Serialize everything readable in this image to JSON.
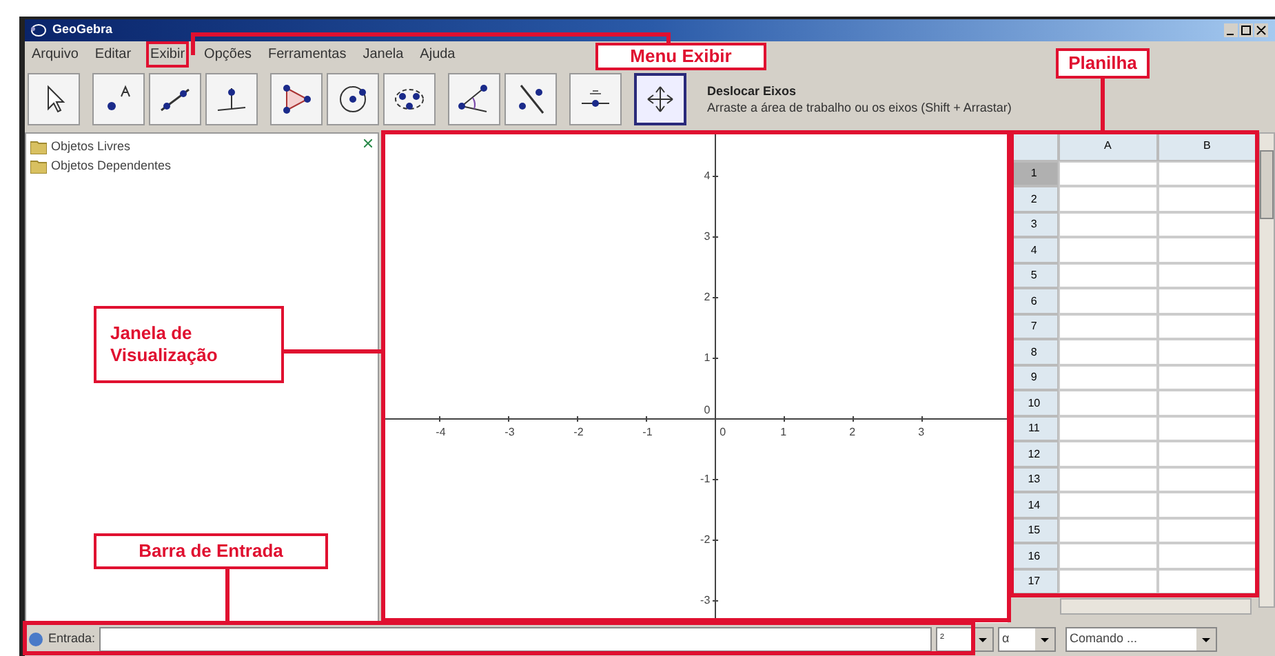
{
  "window": {
    "title": "GeoGebra"
  },
  "menu": [
    {
      "label": "Arquivo",
      "annotated": false
    },
    {
      "label": "Editar",
      "annotated": false
    },
    {
      "label": "Exibir",
      "annotated": true
    },
    {
      "label": "Opções",
      "annotated": false
    },
    {
      "label": "Ferramentas",
      "annotated": false
    },
    {
      "label": "Janela",
      "annotated": false
    },
    {
      "label": "Ajuda",
      "annotated": false
    }
  ],
  "toolbar": {
    "tools": [
      {
        "kind": "move",
        "selected": false
      },
      {
        "kind": "point",
        "selected": false
      },
      {
        "kind": "line",
        "selected": false
      },
      {
        "kind": "perpendicular",
        "selected": false
      },
      {
        "kind": "polygon",
        "selected": false
      },
      {
        "kind": "circle",
        "selected": false
      },
      {
        "kind": "conic",
        "selected": false
      },
      {
        "kind": "angle",
        "selected": false
      },
      {
        "kind": "reflect",
        "selected": false
      },
      {
        "kind": "slider",
        "selected": false
      },
      {
        "kind": "move-view",
        "selected": true
      }
    ],
    "tool_name": "Deslocar Eixos",
    "tool_help": "Arraste a área de trabalho ou os eixos (Shift + Arrastar)"
  },
  "algebra": {
    "folders": [
      "Objetos Livres",
      "Objetos Dependentes"
    ]
  },
  "graphics": {
    "x_ticks": [
      "-4",
      "-3",
      "-2",
      "-1",
      "0",
      "1",
      "2",
      "3"
    ],
    "y_ticks": [
      "4",
      "3",
      "2",
      "1",
      "0",
      "-1",
      "-2",
      "-3"
    ]
  },
  "spreadsheet": {
    "columns": [
      "A",
      "B"
    ],
    "rows": [
      {
        "label": "1",
        "selected": true
      },
      {
        "label": "2",
        "selected": false
      },
      {
        "label": "3",
        "selected": false
      },
      {
        "label": "4",
        "selected": false
      },
      {
        "label": "5",
        "selected": false
      },
      {
        "label": "6",
        "selected": false
      },
      {
        "label": "7",
        "selected": false
      },
      {
        "label": "8",
        "selected": false
      },
      {
        "label": "9",
        "selected": false
      },
      {
        "label": "10",
        "selected": false
      },
      {
        "label": "11",
        "selected": false
      },
      {
        "label": "12",
        "selected": false
      },
      {
        "label": "13",
        "selected": false
      },
      {
        "label": "14",
        "selected": false
      },
      {
        "label": "15",
        "selected": false
      },
      {
        "label": "16",
        "selected": false
      },
      {
        "label": "17",
        "selected": false
      }
    ]
  },
  "input_bar": {
    "label": "Entrada:",
    "dropdowns": [
      "²",
      "α",
      "Comando ..."
    ]
  },
  "annotations": [
    {
      "text": "Menu Exibir"
    },
    {
      "text": "Planilha"
    },
    {
      "text": "Janela de Visualização"
    },
    {
      "text": "Barra de Entrada"
    }
  ]
}
